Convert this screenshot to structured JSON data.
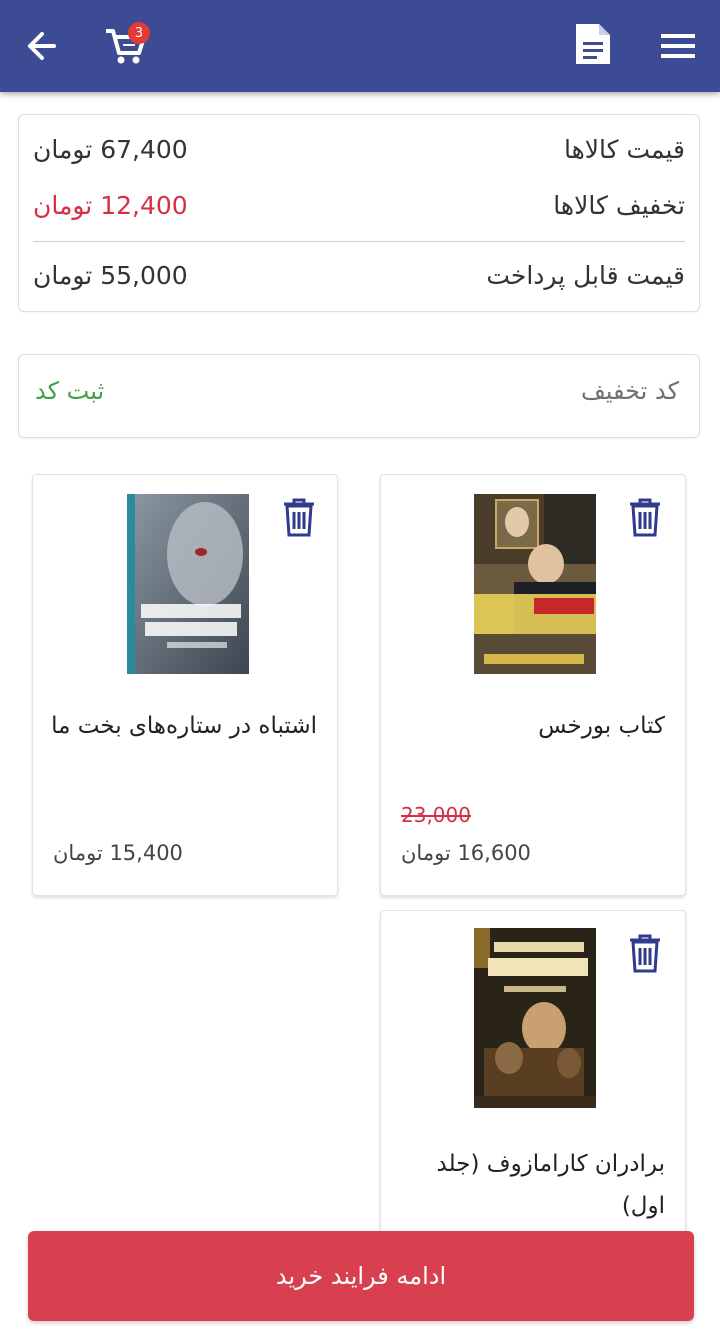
{
  "header": {
    "cart_count": "3",
    "icons": [
      "back-arrow-icon",
      "cart-icon",
      "document-icon",
      "menu-icon"
    ]
  },
  "summary": {
    "items_price_label": "قیمت کالاها",
    "items_price_value": "67,400 تومان",
    "discount_label": "تخفیف کالاها",
    "discount_value": "12,400 تومان",
    "payable_label": "قیمت قابل پرداخت",
    "payable_value": "55,000 تومان"
  },
  "coupon": {
    "placeholder": "کد تخفیف",
    "apply_label": "ثبت کد"
  },
  "products": [
    {
      "title": "کتاب بورخس",
      "old_price": "23,000",
      "price": "16,600 تومان"
    },
    {
      "title": "اشتباه در ستاره‌های بخت ما",
      "price": "15,400 تومان"
    },
    {
      "title": "برادران کارامازوف (جلد اول)"
    }
  ],
  "checkout_button": "ادامه فرایند خرید",
  "colors": {
    "topbar": "#3d4a94",
    "discount_red": "#d32f45",
    "apply_green": "#43a047",
    "cta_red": "#d8404f"
  }
}
